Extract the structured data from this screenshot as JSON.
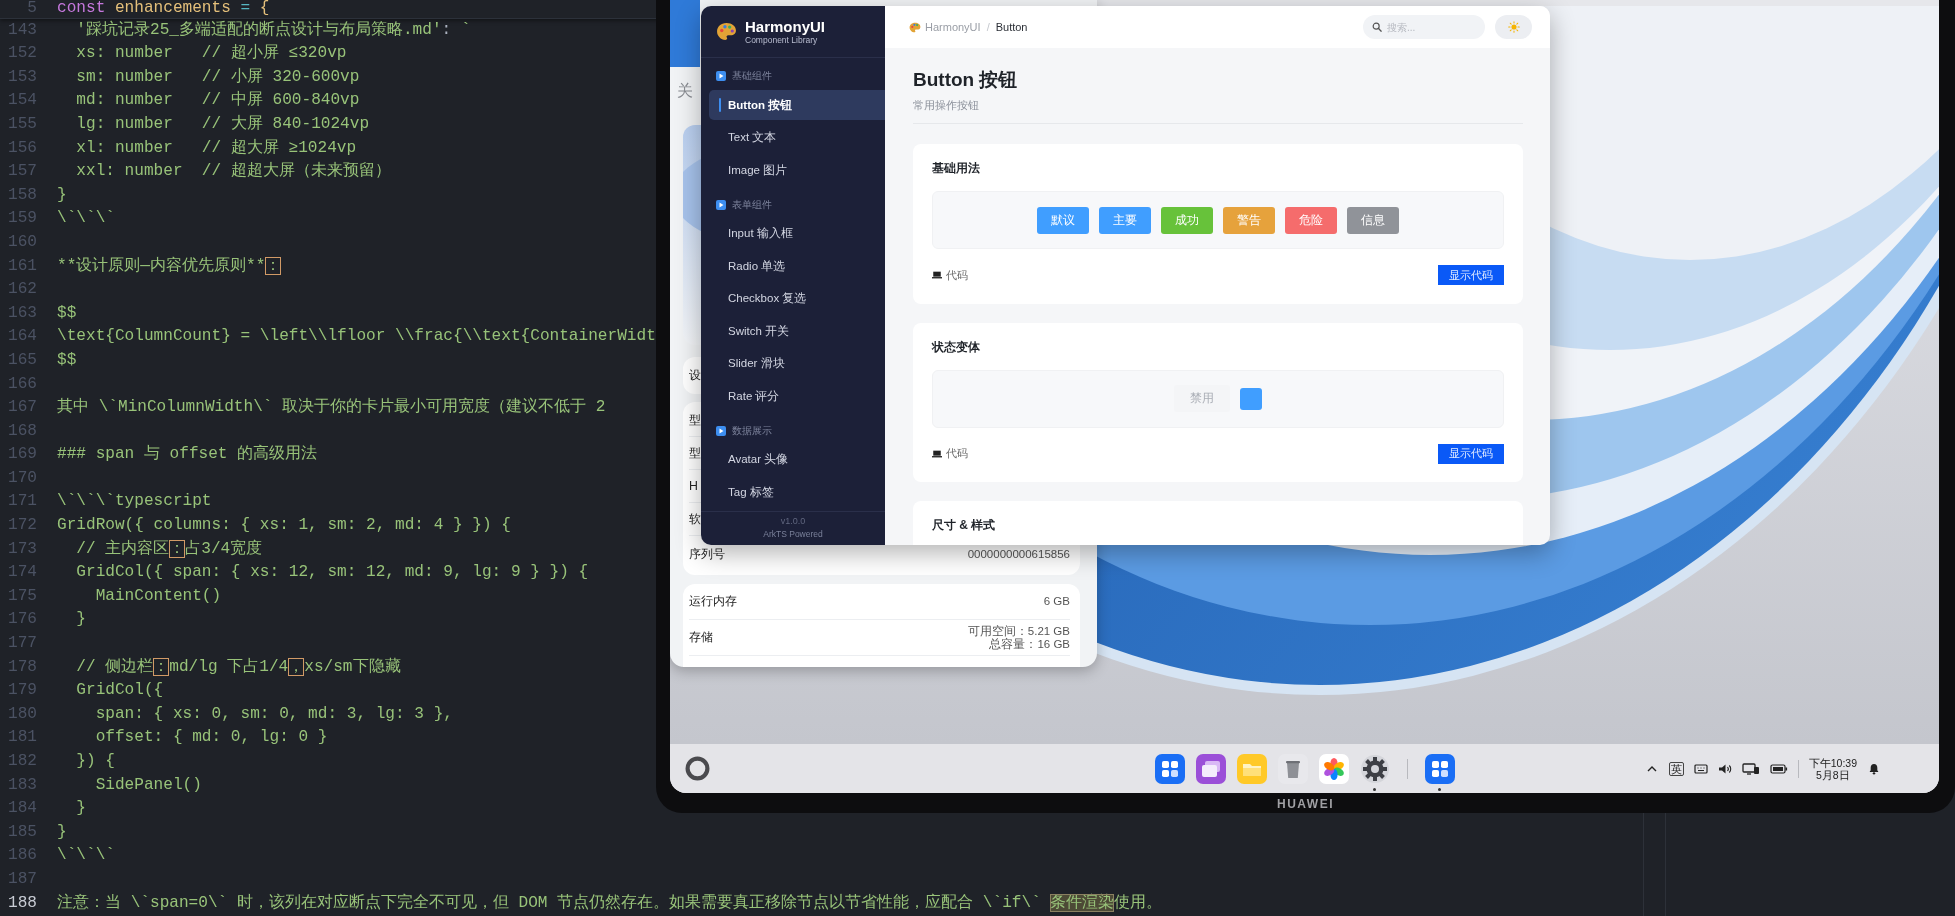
{
  "editor": {
    "lines": [
      {
        "number": "5",
        "kind": "sticky",
        "current": false,
        "segments": [
          {
            "text": "const ",
            "kind": "keyword"
          },
          {
            "text": "enhancements ",
            "kind": "variable"
          },
          {
            "text": "= ",
            "kind": "operator"
          },
          {
            "text": "{",
            "kind": "variable"
          }
        ]
      },
      {
        "number": "143",
        "kind": "code",
        "current": false,
        "segments": [
          {
            "text": "  '踩坑记录25_多端适配的断点设计与布局策略.md'",
            "kind": "string"
          },
          {
            "text": ": ",
            "kind": "plain"
          },
          {
            "text": "`",
            "kind": "string"
          }
        ]
      },
      {
        "number": "152",
        "kind": "code",
        "current": false,
        "segments": [
          {
            "text": "  xs: number   // 超小屏 ≤320vp",
            "kind": "string"
          }
        ]
      },
      {
        "number": "153",
        "kind": "code",
        "current": false,
        "segments": [
          {
            "text": "  sm: number   // 小屏 320-600vp",
            "kind": "string"
          }
        ]
      },
      {
        "number": "154",
        "kind": "code",
        "current": false,
        "segments": [
          {
            "text": "  md: number   // 中屏 600-840vp",
            "kind": "string"
          }
        ]
      },
      {
        "number": "155",
        "kind": "code",
        "current": false,
        "segments": [
          {
            "text": "  lg: number   // 大屏 840-1024vp",
            "kind": "string"
          }
        ]
      },
      {
        "number": "156",
        "kind": "code",
        "current": false,
        "segments": [
          {
            "text": "  xl: number   // 超大屏 ≥1024vp",
            "kind": "string"
          }
        ]
      },
      {
        "number": "157",
        "kind": "code",
        "current": false,
        "segments": [
          {
            "text": "  xxl: number  // 超超大屏（未来预留）",
            "kind": "string"
          }
        ]
      },
      {
        "number": "158",
        "kind": "code",
        "current": false,
        "segments": [
          {
            "text": "}",
            "kind": "string"
          }
        ]
      },
      {
        "number": "159",
        "kind": "code",
        "current": false,
        "segments": [
          {
            "text": "\\`\\`\\`",
            "kind": "string"
          }
        ]
      },
      {
        "number": "160",
        "kind": "code",
        "current": false
      },
      {
        "number": "161",
        "kind": "code",
        "current": false,
        "segments": [
          {
            "text": "**设计原则—内容优先原则**",
            "kind": "string"
          },
          {
            "text": "：",
            "kind": "boxed"
          }
        ]
      },
      {
        "number": "162",
        "kind": "code",
        "current": false
      },
      {
        "number": "163",
        "kind": "code",
        "current": false,
        "segments": [
          {
            "text": "$$",
            "kind": "string"
          }
        ]
      },
      {
        "number": "164",
        "kind": "code",
        "current": false,
        "segments": [
          {
            "text": "\\text{ColumnCount} = \\left\\\\lfloor \\\\frac{\\\\text{ContainerWidt",
            "kind": "string"
          }
        ]
      },
      {
        "number": "165",
        "kind": "code",
        "current": false,
        "segments": [
          {
            "text": "$$",
            "kind": "string"
          }
        ]
      },
      {
        "number": "166",
        "kind": "code",
        "current": false
      },
      {
        "number": "167",
        "kind": "code",
        "current": false,
        "segments": [
          {
            "text": "其中 \\`MinColumnWidth\\` 取决于你的卡片最小可用宽度（建议不低于 2",
            "kind": "string"
          }
        ]
      },
      {
        "number": "168",
        "kind": "code",
        "current": false
      },
      {
        "number": "169",
        "kind": "code",
        "current": false,
        "segments": [
          {
            "text": "### span 与 offset 的高级用法",
            "kind": "string"
          }
        ]
      },
      {
        "number": "170",
        "kind": "code",
        "current": false
      },
      {
        "number": "171",
        "kind": "code",
        "current": false,
        "segments": [
          {
            "text": "\\`\\`\\`typescript",
            "kind": "string"
          }
        ]
      },
      {
        "number": "172",
        "kind": "code",
        "current": false,
        "segments": [
          {
            "text": "GridRow({ columns: { xs: 1, sm: 2, md: 4 } }) {",
            "kind": "string"
          }
        ]
      },
      {
        "number": "173",
        "kind": "code",
        "current": false,
        "segments": [
          {
            "text": "  // 主内容区",
            "kind": "string"
          },
          {
            "text": "：",
            "kind": "boxed"
          },
          {
            "text": "占3/4宽度",
            "kind": "string"
          }
        ]
      },
      {
        "number": "174",
        "kind": "code",
        "current": false,
        "segments": [
          {
            "text": "  GridCol({ span: { xs: 12, sm: 12, md: 9, lg: 9 } }) {",
            "kind": "string"
          }
        ]
      },
      {
        "number": "175",
        "kind": "code",
        "current": false,
        "segments": [
          {
            "text": "    MainContent()",
            "kind": "string"
          }
        ]
      },
      {
        "number": "176",
        "kind": "code",
        "current": false,
        "segments": [
          {
            "text": "  }",
            "kind": "string"
          }
        ]
      },
      {
        "number": "177",
        "kind": "code",
        "current": false
      },
      {
        "number": "178",
        "kind": "code",
        "current": false,
        "segments": [
          {
            "text": "  // 侧边栏",
            "kind": "string"
          },
          {
            "text": "：",
            "kind": "boxed"
          },
          {
            "text": "md/lg 下占1/4",
            "kind": "string"
          },
          {
            "text": "，",
            "kind": "boxed"
          },
          {
            "text": "xs/sm下隐藏",
            "kind": "string"
          }
        ]
      },
      {
        "number": "179",
        "kind": "code",
        "current": false,
        "segments": [
          {
            "text": "  GridCol({",
            "kind": "string"
          }
        ]
      },
      {
        "number": "180",
        "kind": "code",
        "current": false,
        "segments": [
          {
            "text": "    span: { xs: 0, sm: 0, md: 3, lg: 3 },",
            "kind": "string"
          }
        ]
      },
      {
        "number": "181",
        "kind": "code",
        "current": false,
        "segments": [
          {
            "text": "    offset: { md: 0, lg: 0 }",
            "kind": "string"
          }
        ]
      },
      {
        "number": "182",
        "kind": "code",
        "current": false,
        "segments": [
          {
            "text": "  }) {",
            "kind": "string"
          }
        ]
      },
      {
        "number": "183",
        "kind": "code",
        "current": false,
        "segments": [
          {
            "text": "    SidePanel()",
            "kind": "string"
          }
        ]
      },
      {
        "number": "184",
        "kind": "code",
        "current": false,
        "segments": [
          {
            "text": "  }",
            "kind": "string"
          }
        ]
      },
      {
        "number": "185",
        "kind": "code",
        "current": false,
        "segments": [
          {
            "text": "}",
            "kind": "string"
          }
        ]
      },
      {
        "number": "186",
        "kind": "code",
        "current": false,
        "segments": [
          {
            "text": "\\`\\`\\`",
            "kind": "string"
          }
        ]
      },
      {
        "number": "187",
        "kind": "code",
        "current": false
      },
      {
        "number": "188",
        "kind": "code",
        "current": true,
        "segments": [
          {
            "text": "注意：当 \\`span=0\\` 时，该列在对应断点下完全不可见，但 DOM 节点仍然存在。如果需要真正移除节点以节省性能，应配合 \\`if\\` ",
            "kind": "string"
          },
          {
            "text": "条件渲染",
            "kind": "found"
          },
          {
            "text": "使用。",
            "kind": "string"
          }
        ]
      }
    ]
  },
  "device": {
    "brand": "HUAWEI"
  },
  "settings_window": {
    "title": "关",
    "cards": [
      {
        "rows": [
          {
            "label": "设"
          }
        ]
      },
      {
        "rows": [
          {
            "label": "型"
          },
          {
            "label": "型"
          },
          {
            "label": "H"
          },
          {
            "label": "软"
          },
          {
            "label": "序列号",
            "value": "0000000000615856"
          }
        ]
      },
      {
        "rows": [
          {
            "label": "运行内存",
            "value": "6 GB"
          },
          {
            "label": "存储",
            "value_lines": [
              "可用空间：5.21 GB",
              "总容量：16 GB"
            ]
          }
        ]
      }
    ]
  },
  "app": {
    "brand": {
      "name": "HarmonyUI",
      "subtitle": "Component Library"
    },
    "nav": [
      {
        "section": "基础组件",
        "items": [
          {
            "label": "Button 按钮",
            "selected": true
          },
          {
            "label": "Text 文本",
            "selected": false
          },
          {
            "label": "Image 图片",
            "selected": false
          }
        ]
      },
      {
        "section": "表单组件",
        "items": [
          {
            "label": "Input 输入框",
            "selected": false
          },
          {
            "label": "Radio 单选",
            "selected": false
          },
          {
            "label": "Checkbox 复选",
            "selected": false
          },
          {
            "label": "Switch 开关",
            "selected": false
          },
          {
            "label": "Slider 滑块",
            "selected": false
          },
          {
            "label": "Rate 评分",
            "selected": false
          }
        ]
      },
      {
        "section": "数据展示",
        "items": [
          {
            "label": "Avatar 头像",
            "selected": false
          },
          {
            "label": "Tag 标签",
            "selected": false
          }
        ]
      }
    ],
    "version": "v1.0.0",
    "powered": "ArkTS Powered",
    "breadcrumb": {
      "root": "HarmonyUI",
      "separator": "/",
      "current": "Button"
    },
    "search": {
      "placeholder": "搜索..."
    },
    "page": {
      "title": "Button 按钮",
      "subtitle": "常用操作按钮"
    },
    "cards": [
      {
        "title": "基础用法",
        "demo": [
          {
            "label": "默议",
            "kind": "solid",
            "color": "#409eff"
          },
          {
            "label": "主要",
            "kind": "solid",
            "color": "#409eff"
          },
          {
            "label": "成功",
            "kind": "solid",
            "color": "#67c23a"
          },
          {
            "label": "警告",
            "kind": "solid",
            "color": "#e6a23c"
          },
          {
            "label": "危险",
            "kind": "solid",
            "color": "#f56c6c"
          },
          {
            "label": "信息",
            "kind": "solid",
            "color": "#909399"
          }
        ],
        "code_label": "代码",
        "toggle": "显示代码"
      },
      {
        "title": "状态变体",
        "demo": [
          {
            "label": "禁用",
            "kind": "disabled"
          },
          {
            "kind": "square",
            "color": "#409eff"
          }
        ],
        "code_label": "代码",
        "toggle": "显示代码"
      },
      {
        "title": "尺寸 & 样式"
      }
    ]
  },
  "taskbar": {
    "pinned": [
      {
        "kind": "grid",
        "running": false
      },
      {
        "kind": "windows",
        "running": false
      },
      {
        "kind": "folder",
        "running": false
      },
      {
        "kind": "trash",
        "running": false
      },
      {
        "kind": "photos",
        "running": false
      },
      {
        "kind": "settings",
        "running": true
      }
    ],
    "open": [
      {
        "kind": "grid",
        "running": true
      }
    ],
    "input_method": "英",
    "time": "下午10:39",
    "date": "5月8日"
  }
}
